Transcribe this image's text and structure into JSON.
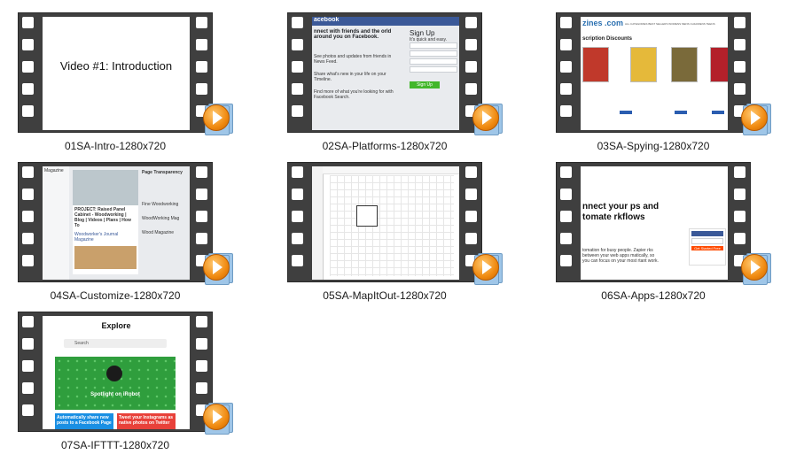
{
  "videos": [
    {
      "filename": "01SA-Intro-1280x720",
      "screen_title": "Video #1: Introduction"
    },
    {
      "filename": "02SA-Platforms-1280x720",
      "brand": "acebook",
      "headline": "nnect with friends and the orld around you on Facebook.",
      "signup_title": "Sign Up",
      "signup_sub": "It's quick and easy.",
      "feature1": "See photos and updates from friends in News Feed.",
      "feature2": "Share what's new in your life on your Timeline.",
      "feature3": "Find more of what you're looking for with Facebook Search.",
      "signup_button": "Sign Up"
    },
    {
      "filename": "03SA-Spying-1280x720",
      "brand": "zines .com",
      "section": "scription Discounts",
      "nav": "ALL CATEGORIES   BEST SELLERS   WOMENS   MENS   CHILDRENS   TEENS"
    },
    {
      "filename": "04SA-Customize-1280x720",
      "brand": "Magazine",
      "post_title": "PROJECT: Raised Panel Cabinet - Woodworking | Blog | Videos | Plans | How To",
      "page_name": "Woodworker's Journal Magazine",
      "side_title": "Page Transparency",
      "side_item1": "Fine Woodworking",
      "side_item2": "WoodWorking Mag",
      "side_item3": "Wood Magazine"
    },
    {
      "filename": "05SA-MapItOut-1280x720"
    },
    {
      "filename": "06SA-Apps-1280x720",
      "headline": "nnect your ps and tomate rkflows",
      "subtext": "tomation for busy people. Zapier rks between your web apps matically, so you can focus on your most rtant work.",
      "cta": "Get Started Free"
    },
    {
      "filename": "07SA-IFTTT-1280x720",
      "title": "Explore",
      "search_placeholder": "Search",
      "banner_label": "Spotlight on iRobot",
      "card1": "Automatically share new posts to a Facebook Page",
      "card2": "Tweet your Instagrams as native photos on Twitter"
    }
  ],
  "colors": {
    "film": "#3f3f3f",
    "facebook_blue": "#3b5998",
    "play_orange": "#f08a10"
  },
  "icons": {
    "play_overlay": "media-player-play-icon"
  }
}
